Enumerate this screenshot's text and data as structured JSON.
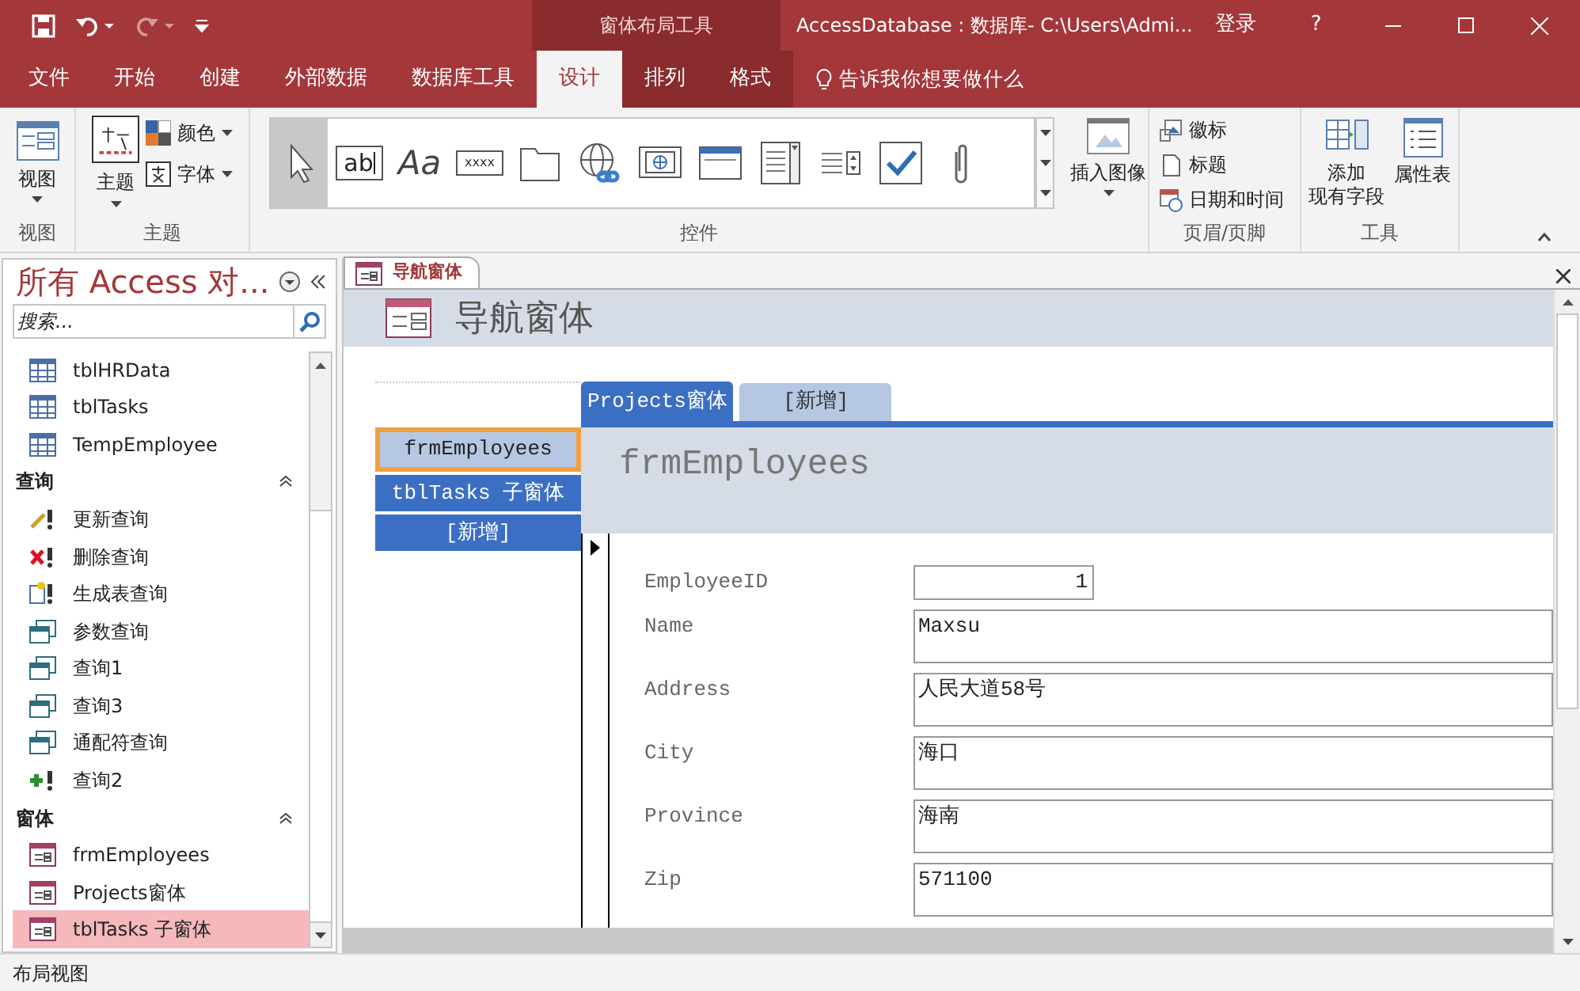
{
  "title_bar": {
    "context_tab": "窗体布局工具",
    "title": "AccessDatabase : 数据库- C:\\Users\\Admi...",
    "login": "登录",
    "help": "?"
  },
  "ribbon_tabs": [
    {
      "label": "文件",
      "selected": false
    },
    {
      "label": "开始",
      "selected": false
    },
    {
      "label": "创建",
      "selected": false
    },
    {
      "label": "外部数据",
      "selected": false
    },
    {
      "label": "数据库工具",
      "selected": false
    },
    {
      "label": "设计",
      "selected": true
    },
    {
      "label": "排列",
      "selected": false
    },
    {
      "label": "格式",
      "selected": false
    }
  ],
  "tell_me": "告诉我你想要做什么",
  "ribbon": {
    "view": {
      "button": "视图",
      "group": "视图"
    },
    "theme": {
      "button": "主题",
      "colors": "颜色",
      "fonts": "字体",
      "group": "主题"
    },
    "controls": [
      {
        "kind": "select",
        "selected": true
      },
      {
        "kind": "textbox",
        "label": "ab",
        "selected": false
      },
      {
        "kind": "label",
        "label": "Aa",
        "selected": false
      },
      {
        "kind": "button",
        "label": "xxxx",
        "selected": false
      },
      {
        "kind": "tab",
        "selected": false
      },
      {
        "kind": "hyperlink",
        "selected": false
      },
      {
        "kind": "web",
        "selected": false
      },
      {
        "kind": "navigation",
        "selected": false
      },
      {
        "kind": "combo",
        "selected": false
      },
      {
        "kind": "list",
        "selected": false
      },
      {
        "kind": "checkbox",
        "selected": false
      },
      {
        "kind": "attachment",
        "selected": false
      }
    ],
    "insert_image": "插入图像",
    "controls_group": "控件",
    "header_footer": {
      "items": [
        "徽标",
        "标题",
        "日期和时间"
      ],
      "group": "页眉/页脚"
    },
    "tools": {
      "add_fields": [
        "添加",
        "现有字段"
      ],
      "property_sheet": "属性表",
      "group": "工具"
    }
  },
  "nav_pane": {
    "title": "所有 Access 对...",
    "search": {
      "placeholder": "搜索..."
    },
    "items": [
      {
        "kind": "table",
        "label": "tblHRData",
        "selected": false
      },
      {
        "kind": "table",
        "label": "tblTasks",
        "selected": false
      },
      {
        "kind": "table",
        "label": "TempEmployee",
        "selected": false
      },
      {
        "kind": "section",
        "label": "查询",
        "expanded": true
      },
      {
        "kind": "update-query",
        "label": "更新查询",
        "selected": false
      },
      {
        "kind": "delete-query",
        "label": "删除查询",
        "selected": false
      },
      {
        "kind": "make-table-query",
        "label": "生成表查询",
        "selected": false
      },
      {
        "kind": "select-query",
        "label": "参数查询",
        "selected": false
      },
      {
        "kind": "select-query",
        "label": "查询1",
        "selected": false
      },
      {
        "kind": "select-query",
        "label": "查询3",
        "selected": false
      },
      {
        "kind": "select-query",
        "label": "通配符查询",
        "selected": false
      },
      {
        "kind": "append-query",
        "label": "查询2",
        "selected": false
      },
      {
        "kind": "section",
        "label": "窗体",
        "expanded": true
      },
      {
        "kind": "form",
        "label": "frmEmployees",
        "selected": false
      },
      {
        "kind": "form",
        "label": "Projects窗体",
        "selected": false
      },
      {
        "kind": "form",
        "label": "tblTasks 子窗体",
        "selected": true
      }
    ]
  },
  "document": {
    "tab": "导航窗体",
    "form_title": "导航窗体",
    "top_tabs": [
      {
        "label": "Projects窗体",
        "selected": true
      },
      {
        "label": "[新增]",
        "selected": false
      }
    ],
    "side_tabs": [
      {
        "label": "frmEmployees",
        "selected": true
      },
      {
        "label": "tblTasks 子窗体",
        "selected": false
      },
      {
        "label": "[新增]",
        "selected": false
      }
    ],
    "subform_title": "frmEmployees",
    "fields": [
      {
        "label": "EmployeeID",
        "value": "1",
        "kind": "number"
      },
      {
        "label": "Name",
        "value": "Maxsu",
        "kind": "text"
      },
      {
        "label": "Address",
        "value": "人民大道58号",
        "kind": "text"
      },
      {
        "label": "City",
        "value": "海口",
        "kind": "text"
      },
      {
        "label": "Province",
        "value": "海南",
        "kind": "text"
      },
      {
        "label": "Zip",
        "value": "571100",
        "kind": "text"
      }
    ]
  },
  "status_bar": "布局视图"
}
